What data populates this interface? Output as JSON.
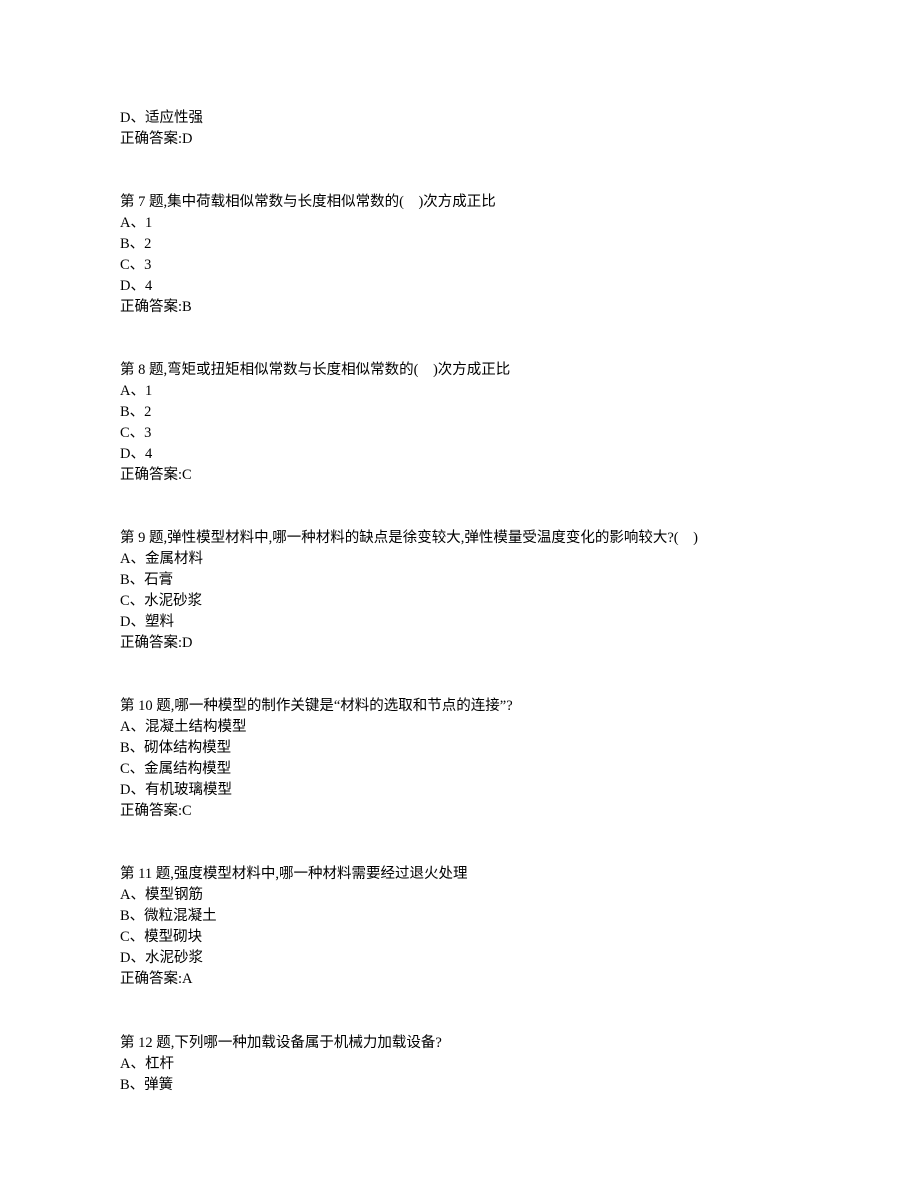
{
  "orphan": {
    "option_d": "D、适应性强",
    "answer": "正确答案:D"
  },
  "q7": {
    "question": "第 7 题,集中荷载相似常数与长度相似常数的(    )次方成正比",
    "a": "A、1",
    "b": "B、2",
    "c": "C、3",
    "d": "D、4",
    "answer": "正确答案:B"
  },
  "q8": {
    "question": "第 8 题,弯矩或扭矩相似常数与长度相似常数的(    )次方成正比",
    "a": "A、1",
    "b": "B、2",
    "c": "C、3",
    "d": "D、4",
    "answer": "正确答案:C"
  },
  "q9": {
    "question": "第 9 题,弹性模型材料中,哪一种材料的缺点是徐变较大,弹性模量受温度变化的影响较大?(    )",
    "a": "A、金属材料",
    "b": "B、石膏",
    "c": "C、水泥砂浆",
    "d": "D、塑料",
    "answer": "正确答案:D"
  },
  "q10": {
    "question": "第 10 题,哪一种模型的制作关键是“材料的选取和节点的连接”?",
    "a": "A、混凝土结构模型",
    "b": "B、砌体结构模型",
    "c": "C、金属结构模型",
    "d": "D、有机玻璃模型",
    "answer": "正确答案:C"
  },
  "q11": {
    "question": "第 11 题,强度模型材料中,哪一种材料需要经过退火处理",
    "a": "A、模型钢筋",
    "b": "B、微粒混凝土",
    "c": "C、模型砌块",
    "d": "D、水泥砂浆",
    "answer": "正确答案:A"
  },
  "q12": {
    "question": "第 12 题,下列哪一种加载设备属于机械力加载设备?",
    "a": "A、杠杆",
    "b": "B、弹簧"
  }
}
